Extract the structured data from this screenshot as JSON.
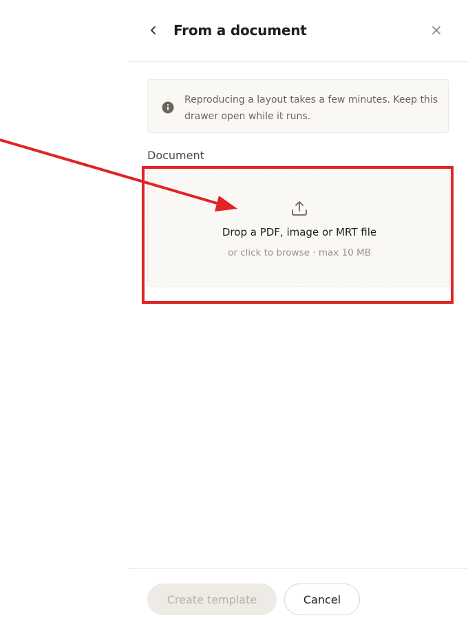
{
  "drawer": {
    "title": "From a document",
    "info_message": "Reproducing a layout takes a few minutes. Keep this drawer open while it runs.",
    "document_label": "Document",
    "dropzone": {
      "title": "Drop a PDF, image or MRT file",
      "hint": "or click to browse · max 10 MB"
    },
    "footer": {
      "create_label": "Create template",
      "cancel_label": "Cancel"
    }
  },
  "icons": {
    "back": "chevron-left-icon",
    "close": "close-icon",
    "info": "info-icon",
    "upload": "upload-icon"
  },
  "colors": {
    "annotation": "#e02424",
    "panel_bg": "#faf8f5",
    "primary_disabled_bg": "#eeebe6",
    "primary_disabled_text": "#b8b1a8"
  }
}
